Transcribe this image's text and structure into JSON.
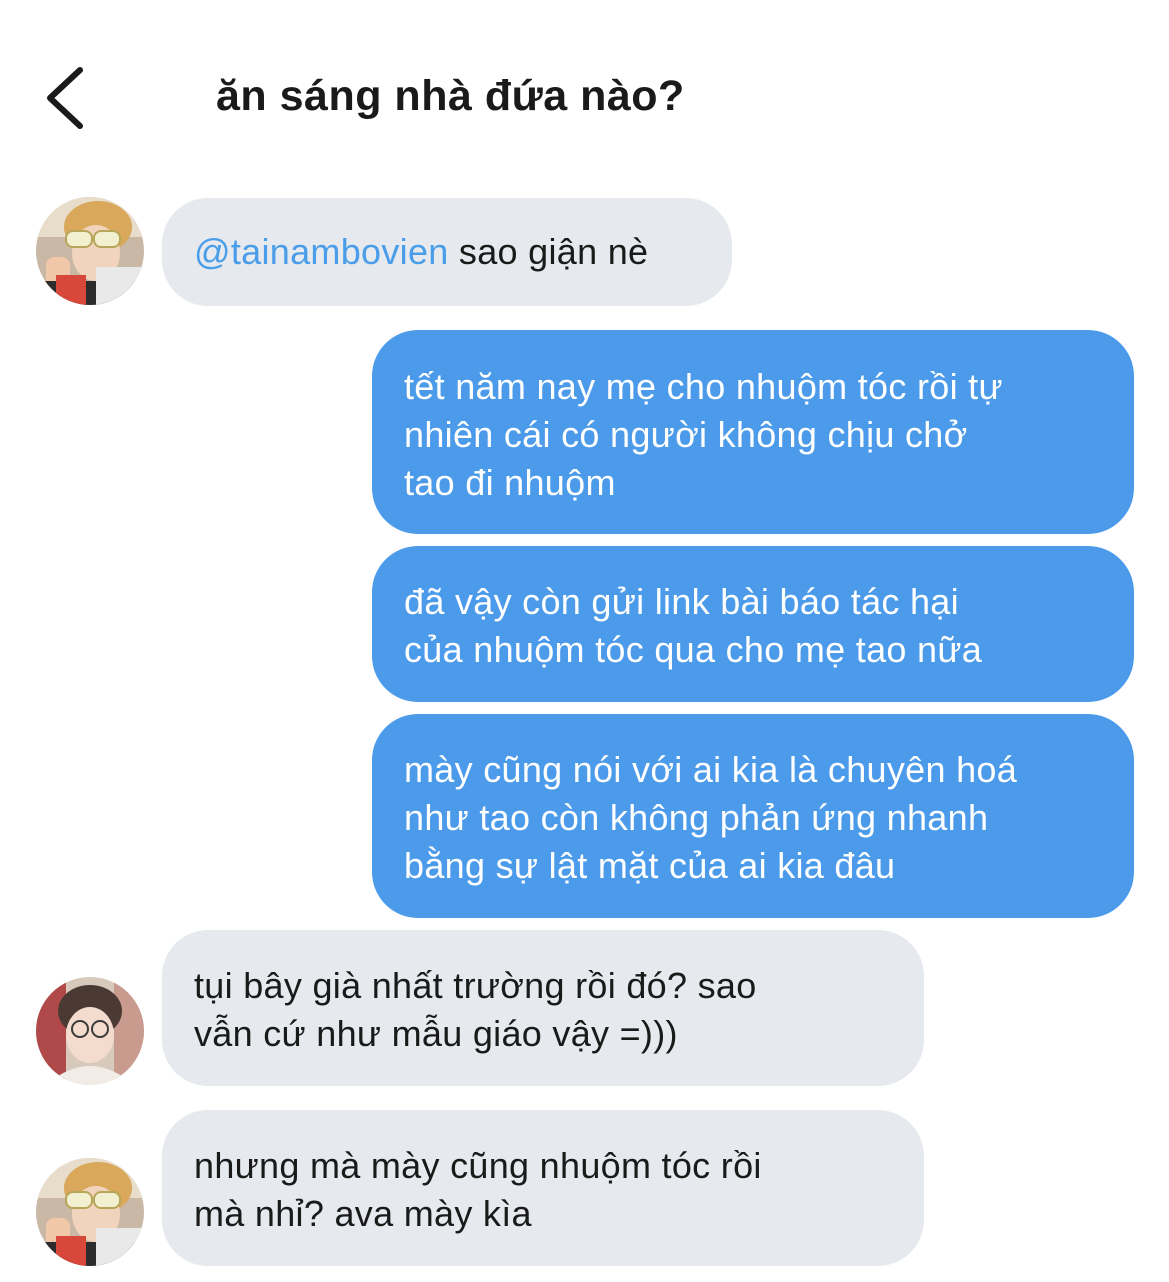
{
  "header": {
    "title": "ăn sáng nhà đứa nào?",
    "back_icon": "chevron-left-icon"
  },
  "messages": [
    {
      "direction": "incoming",
      "mention": "@tainambovien",
      "text": " sao giận nè"
    },
    {
      "direction": "outgoing",
      "lines": [
        "tết năm nay mẹ cho nhuộm tóc rồi tự",
        "nhiên cái có người không chịu chở",
        "tao đi nhuộm"
      ]
    },
    {
      "direction": "outgoing",
      "lines": [
        "đã vậy còn gửi link bài báo tác hại",
        "của nhuộm tóc qua cho mẹ tao nữa"
      ]
    },
    {
      "direction": "outgoing",
      "lines": [
        "mày cũng nói với ai kia là chuyên hoá",
        "như tao còn không phản ứng nhanh",
        "bằng sự lật mặt của ai kia đâu"
      ]
    },
    {
      "direction": "incoming",
      "lines": [
        "tụi bây già nhất trường rồi đó? sao",
        "vẫn cứ như mẫu giáo vậy =)))"
      ]
    },
    {
      "direction": "incoming",
      "lines": [
        "nhưng mà mày cũng nhuộm tóc rồi",
        "mà nhỉ? ava mày kìa"
      ]
    }
  ],
  "colors": {
    "incoming_bubble": "#e6e9ed",
    "outgoing_bubble": "#4c9beb",
    "mention": "#4a9de8"
  }
}
